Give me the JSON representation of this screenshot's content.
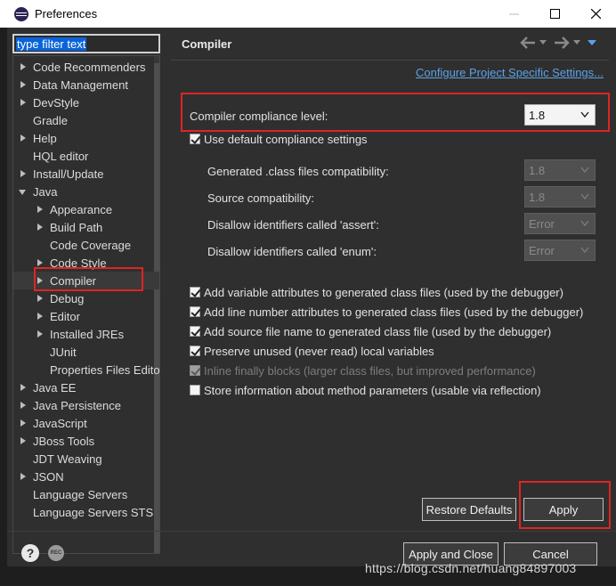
{
  "window": {
    "title": "Preferences"
  },
  "filter": {
    "placeholder": "type filter text"
  },
  "tree": [
    {
      "label": "Code Recommenders",
      "level": 0,
      "twisty": "expand"
    },
    {
      "label": "Data Management",
      "level": 0,
      "twisty": "expand"
    },
    {
      "label": "DevStyle",
      "level": 0,
      "twisty": "expand"
    },
    {
      "label": "Gradle",
      "level": 0,
      "twisty": "none"
    },
    {
      "label": "Help",
      "level": 0,
      "twisty": "expand"
    },
    {
      "label": "HQL editor",
      "level": 0,
      "twisty": "none"
    },
    {
      "label": "Install/Update",
      "level": 0,
      "twisty": "expand"
    },
    {
      "label": "Java",
      "level": 0,
      "twisty": "collapse"
    },
    {
      "label": "Appearance",
      "level": 1,
      "twisty": "expand"
    },
    {
      "label": "Build Path",
      "level": 1,
      "twisty": "expand"
    },
    {
      "label": "Code Coverage",
      "level": 1,
      "twisty": "none"
    },
    {
      "label": "Code Style",
      "level": 1,
      "twisty": "expand"
    },
    {
      "label": "Compiler",
      "level": 1,
      "twisty": "expand",
      "selected": true
    },
    {
      "label": "Debug",
      "level": 1,
      "twisty": "expand"
    },
    {
      "label": "Editor",
      "level": 1,
      "twisty": "expand"
    },
    {
      "label": "Installed JREs",
      "level": 1,
      "twisty": "expand"
    },
    {
      "label": "JUnit",
      "level": 1,
      "twisty": "none"
    },
    {
      "label": "Properties Files Edito",
      "level": 1,
      "twisty": "none"
    },
    {
      "label": "Java EE",
      "level": 0,
      "twisty": "expand"
    },
    {
      "label": "Java Persistence",
      "level": 0,
      "twisty": "expand"
    },
    {
      "label": "JavaScript",
      "level": 0,
      "twisty": "expand"
    },
    {
      "label": "JBoss Tools",
      "level": 0,
      "twisty": "expand"
    },
    {
      "label": "JDT Weaving",
      "level": 0,
      "twisty": "none"
    },
    {
      "label": "JSON",
      "level": 0,
      "twisty": "expand"
    },
    {
      "label": "Language Servers",
      "level": 0,
      "twisty": "none"
    },
    {
      "label": "Language Servers STS",
      "level": 0,
      "twisty": "none"
    }
  ],
  "page": {
    "title": "Compiler",
    "configure_link": "Configure Project Specific Settings...",
    "compliance_label": "Compiler compliance level:",
    "compliance_value": "1.8",
    "use_default": {
      "label": "Use default compliance settings",
      "checked": true
    },
    "sub_settings": [
      {
        "label": "Generated .class files compatibility:",
        "value": "1.8"
      },
      {
        "label": "Source compatibility:",
        "value": "1.8"
      },
      {
        "label": "Disallow identifiers called 'assert':",
        "value": "Error"
      },
      {
        "label": "Disallow identifiers called 'enum':",
        "value": "Error"
      }
    ],
    "options": [
      {
        "label": "Add variable attributes to generated class files (used by the debugger)",
        "checked": true,
        "enabled": true
      },
      {
        "label": "Add line number attributes to generated class files (used by the debugger)",
        "checked": true,
        "enabled": true
      },
      {
        "label": "Add source file name to generated class file (used by the debugger)",
        "checked": true,
        "enabled": true
      },
      {
        "label": "Preserve unused (never read) local variables",
        "checked": true,
        "enabled": true
      },
      {
        "label": "Inline finally blocks (larger class files, but improved performance)",
        "checked": true,
        "enabled": false
      },
      {
        "label": "Store information about method parameters (usable via reflection)",
        "checked": false,
        "enabled": true
      }
    ],
    "restore_defaults_label": "Restore Defaults",
    "apply_label": "Apply"
  },
  "footer": {
    "help_icon_glyph": "?",
    "rec_icon_glyph": "REC",
    "apply_close_label": "Apply and Close",
    "cancel_label": "Cancel"
  },
  "watermark": "https://blog.csdn.net/huang84897003",
  "colors": {
    "highlight_box": "#e02424",
    "link": "#5aa2e8",
    "selection": "#0a64d8"
  }
}
